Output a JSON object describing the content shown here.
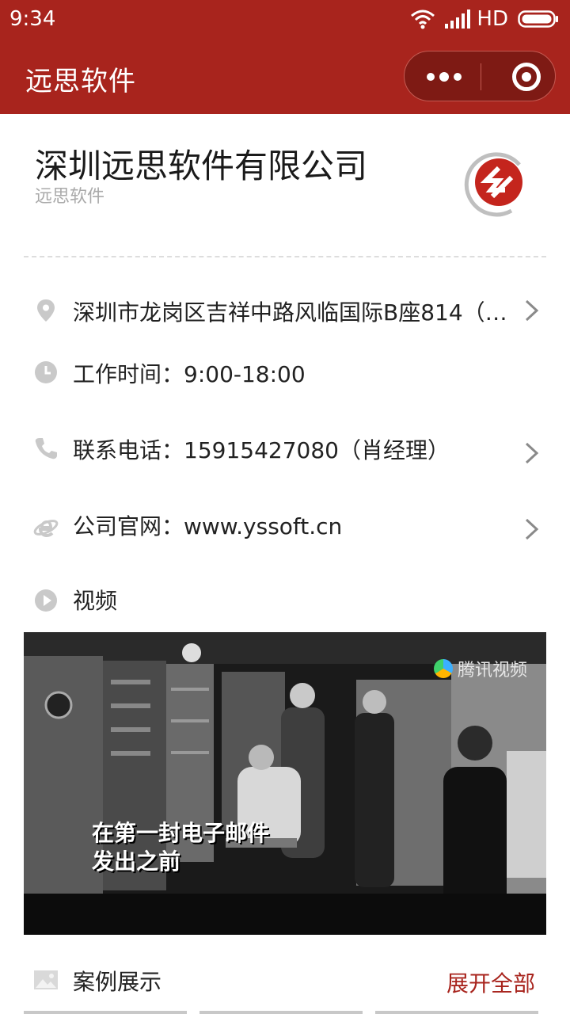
{
  "status_bar": {
    "time": "9:34",
    "network": "HD",
    "icons": [
      "wifi-icon",
      "signal-icon",
      "battery-icon"
    ]
  },
  "nav": {
    "title": "远思软件",
    "more_icon": "more-dots-icon",
    "close_icon": "close-miniprogram-icon"
  },
  "company": {
    "name": "深圳远思软件有限公司",
    "short_name": "远思软件",
    "logo_icon": "company-logo"
  },
  "info": {
    "address": "深圳市龙岗区吉祥中路风临国际B座814（…",
    "hours": "工作时间：9:00-18:00",
    "phone": "联系电话：15915427080（肖经理）",
    "website": "公司官网：www.yssoft.cn",
    "video_label": "视频"
  },
  "video": {
    "caption_line1": "在第一封电子邮件",
    "caption_line2": "发出之前",
    "brand": "腾讯视频"
  },
  "cases": {
    "label": "案例展示",
    "expand": "展开全部"
  },
  "colors": {
    "brand_red": "#a8241d",
    "icon_gray": "#c9c9c9",
    "text": "#222222",
    "subtle": "#aaaaaa"
  }
}
